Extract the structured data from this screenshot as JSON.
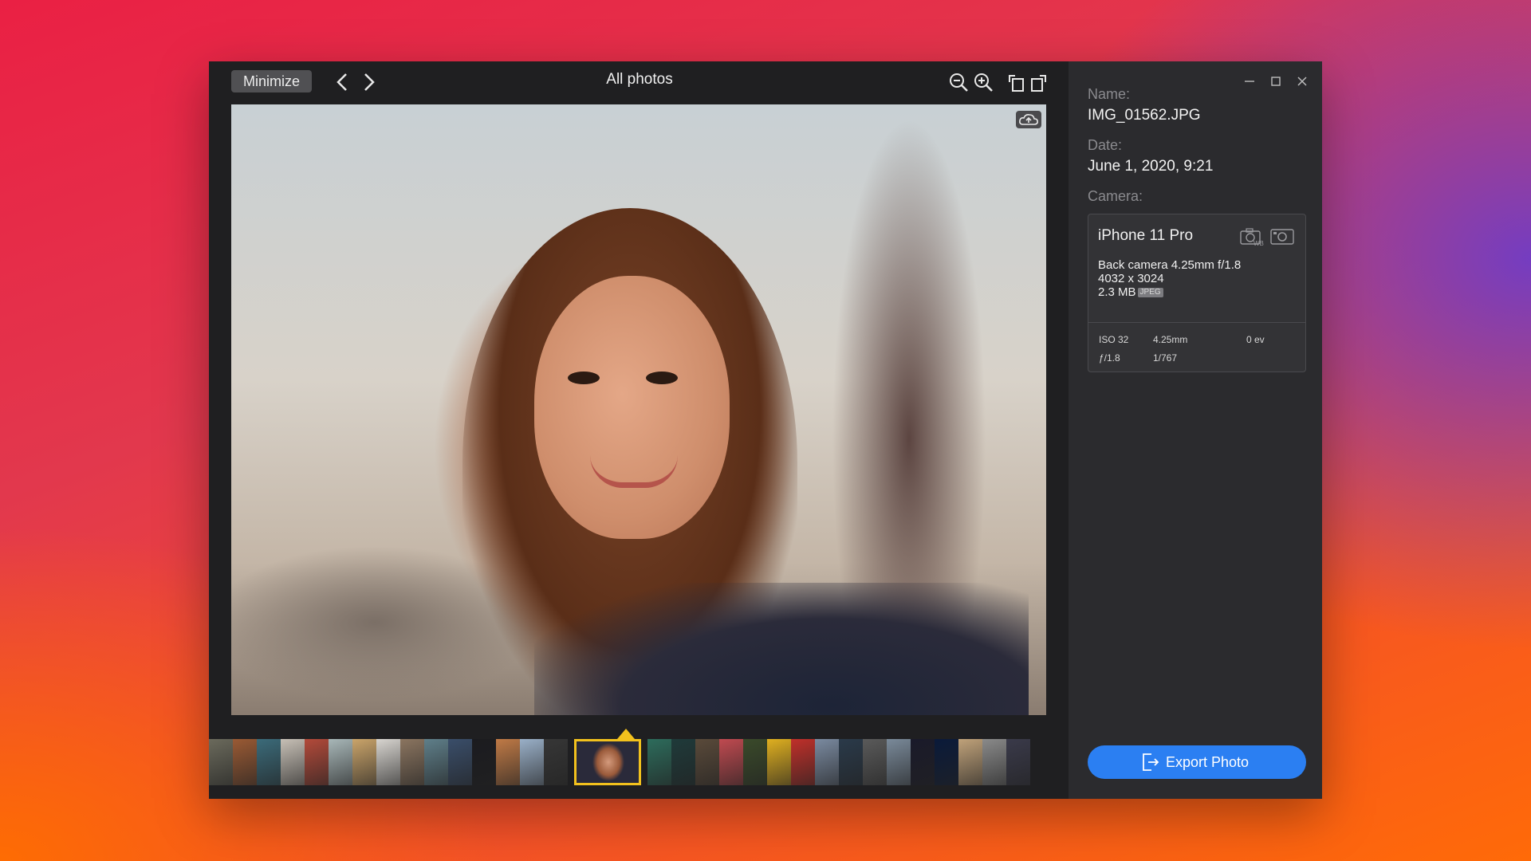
{
  "viewer": {
    "minimize_label": "Minimize",
    "title": "All photos",
    "icons": [
      "chevron-left-icon",
      "chevron-right-icon",
      "zoom-out-icon",
      "zoom-in-icon",
      "rotate-left-icon",
      "rotate-right-icon",
      "cloud-upload-icon"
    ]
  },
  "filmstrip": {
    "selected_index": 15,
    "thumb_colors": [
      "#6b6a5c",
      "#9a5a34",
      "#3b6b7a",
      "#c7c0b6",
      "#b34a3a",
      "#a8b7b8",
      "#caa46a",
      "#d8d5d0",
      "#8b7560",
      "#5f7f8a",
      "#3a4e6a",
      "#1b1b1f",
      "#c07a46",
      "#9ab0c8",
      "#363636",
      "#d6d6d4",
      "#2d6c5c",
      "#1f3a3a",
      "#5a4a3a",
      "#c04a50",
      "#3a4a2a",
      "#e0b020",
      "#c0302a",
      "#7a8aa0",
      "#2a3a4a",
      "#5a5a5a",
      "#7a8a9a",
      "#1a1a2a",
      "#0a1a3a",
      "#c0a27a",
      "#8a8a8a",
      "#3a3a4a"
    ]
  },
  "info": {
    "name_label": "Name:",
    "name_value": "IMG_01562.JPG",
    "date_label": "Date:",
    "date_value": "June 1, 2020, 9:21",
    "camera_label": "Camera:",
    "camera": {
      "model": "iPhone 11 Pro",
      "lens": "Back camera 4.25mm f/1.8",
      "resolution": "4032 x 3024",
      "size": "2.3 MB",
      "format": "JPEG",
      "iso": "ISO 32",
      "focal": "4.25mm",
      "ev": "0 ev",
      "aperture": "ƒ/1.8",
      "shutter": "1/767"
    },
    "export_label": "Export Photo"
  },
  "colors": {
    "accent": "#2b7ff2",
    "selection": "#f2c11d",
    "panel": "#2b2b2e",
    "viewer": "#1f1f21"
  }
}
